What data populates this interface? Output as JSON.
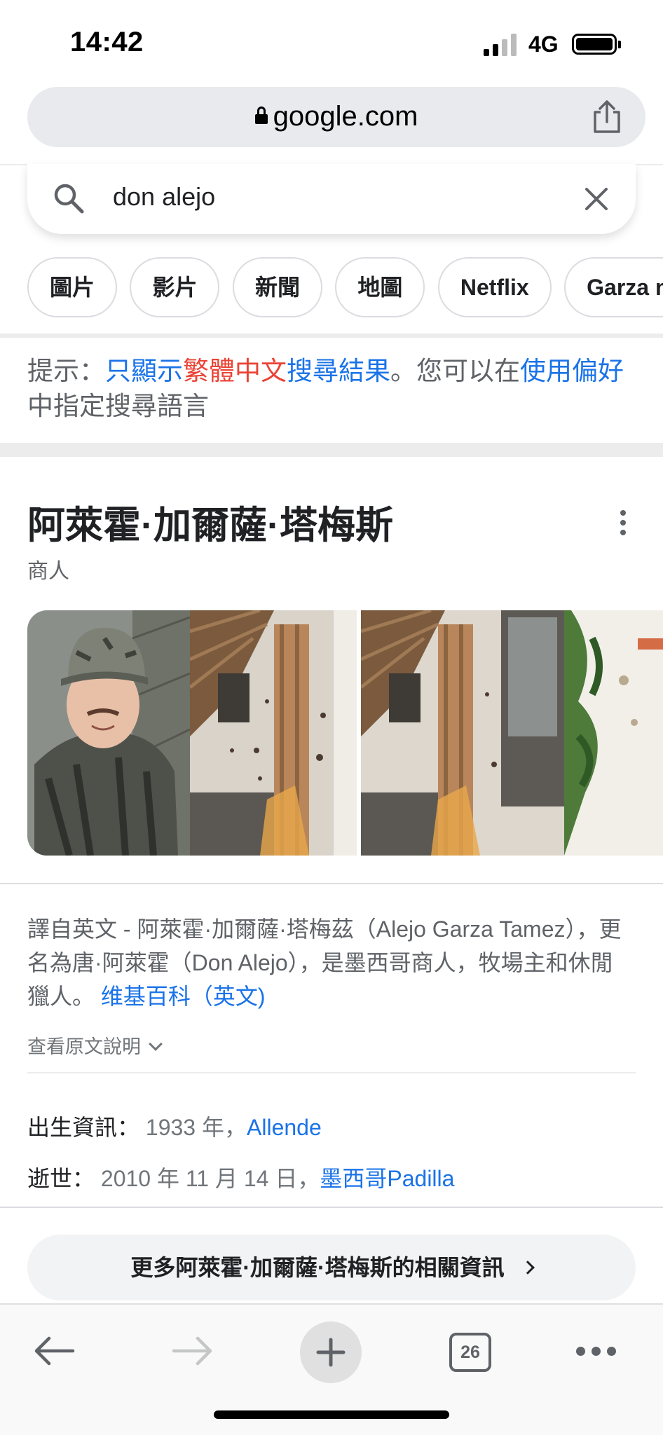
{
  "status_bar": {
    "time": "14:42",
    "network": "4G"
  },
  "browser": {
    "url": "google.com"
  },
  "search": {
    "query": "don alejo"
  },
  "chips": [
    "圖片",
    "影片",
    "新聞",
    "地圖",
    "Netflix",
    "Garza mo"
  ],
  "hint": {
    "prefix": "提示：",
    "link1_part1": "只顯示",
    "link1_part2": "繁體中文",
    "link1_part3": "搜尋結果",
    "middle": "。您可以在",
    "link2": "使用偏好",
    "suffix": "中指定搜尋語言"
  },
  "knowledge_panel": {
    "title": "阿萊霍·加爾薩·塔梅斯",
    "subtitle": "商人",
    "description": "譯自英文 - 阿萊霍·加爾薩·塔梅茲（Alejo Garza Tamez），更名為唐·阿萊霍（Don Alejo），是墨西哥商人，牧場主和休閒獵人。",
    "source_link": "维基百科（英文)",
    "see_original": "查看原文說明",
    "birth_label": "出生資訊：",
    "birth_value": "1933 年，",
    "birth_place": "Allende",
    "death_label": "逝世：",
    "death_value": "2010 年 11 月 14 日，",
    "death_place": "墨西哥Padilla",
    "more_button": "更多阿萊霍·加爾薩·塔梅斯的相關資訊"
  },
  "toolbar": {
    "tab_count": "26"
  }
}
